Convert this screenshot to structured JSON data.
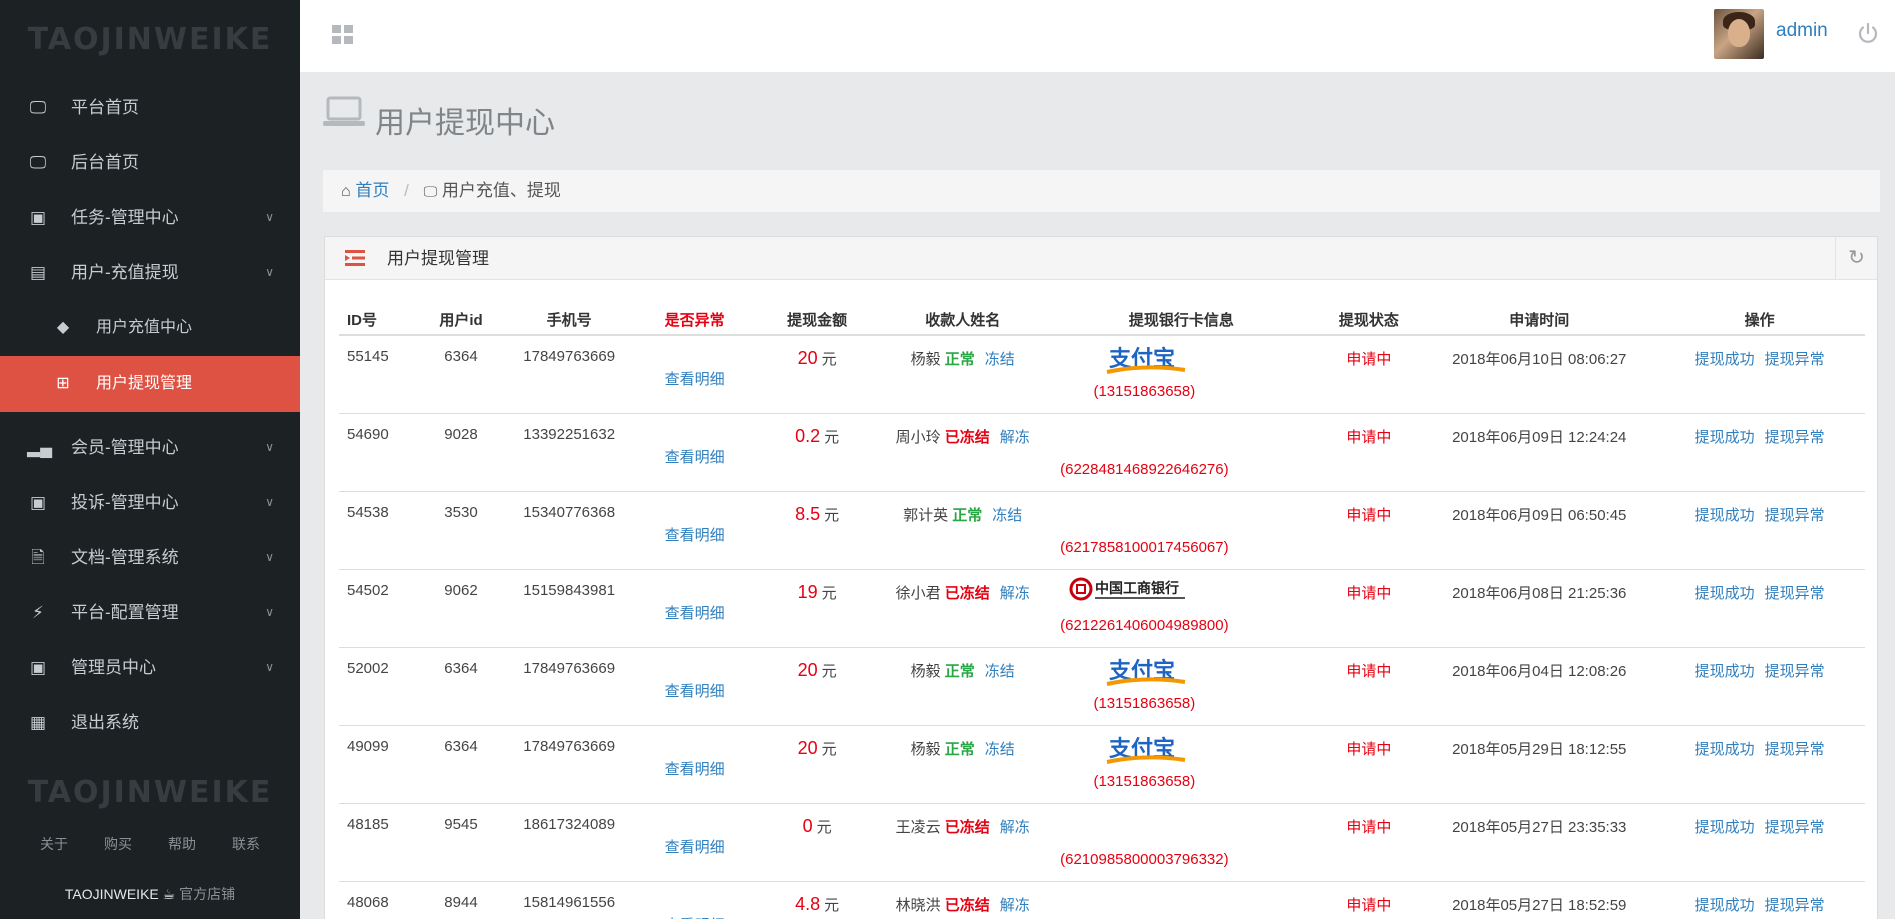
{
  "brand": "TAOJINWEIKE",
  "sidebar": {
    "items": [
      {
        "label": "平台首页",
        "icon": "laptop-icon"
      },
      {
        "label": "后台首页",
        "icon": "laptop-icon"
      },
      {
        "label": "任务-管理中心",
        "icon": "briefcase-icon"
      },
      {
        "label": "用户-充值提现",
        "icon": "list-alt-icon"
      },
      {
        "label": "用户充值中心",
        "icon": "tags-icon"
      },
      {
        "label": "用户提现管理",
        "icon": "plus-square-icon"
      },
      {
        "label": "会员-管理中心",
        "icon": "signal-icon"
      },
      {
        "label": "投诉-管理中心",
        "icon": "briefcase-icon"
      },
      {
        "label": "文档-管理系统",
        "icon": "file-text-icon"
      },
      {
        "label": "平台-配置管理",
        "icon": "bolt-icon"
      },
      {
        "label": "管理员中心",
        "icon": "briefcase-icon"
      },
      {
        "label": "退出系统",
        "icon": "calendar-icon"
      }
    ],
    "footer_brand": "TAOJINWEIKE",
    "footer_links": [
      "关于",
      "购买",
      "帮助",
      "联系"
    ],
    "shop_brand": "TAOJINWEIKE",
    "shop_label": "官方店铺"
  },
  "topbar": {
    "username": "admin"
  },
  "page": {
    "title": "用户提现中心"
  },
  "breadcrumb": {
    "home": "首页",
    "current": "用户充值、提现"
  },
  "panel": {
    "title": "用户提现管理"
  },
  "table": {
    "headers": [
      "ID号",
      "用户id",
      "手机号",
      "是否异常",
      "提现金额",
      "收款人姓名",
      "提现银行卡信息",
      "提现状态",
      "申请时间",
      "操作"
    ],
    "detail_label": "查看明细",
    "currency_unit": "元",
    "op_success": "提现成功",
    "op_abnormal": "提现异常",
    "rows": [
      {
        "id": "55145",
        "uid": "6364",
        "phone": "17849763669",
        "amount": "20",
        "name": "杨毅",
        "status": "正常",
        "action": "冻结",
        "bank_logo": "alipay",
        "account": "(13151863658)",
        "state": "申请中",
        "time": "2018年06月10日 08:06:27"
      },
      {
        "id": "54690",
        "uid": "9028",
        "phone": "13392251632",
        "amount": "0.2",
        "name": "周小玲",
        "status": "已冻结",
        "action": "解冻",
        "bank_logo": "",
        "account": "(6228481468922646276)",
        "state": "申请中",
        "time": "2018年06月09日 12:24:24"
      },
      {
        "id": "54538",
        "uid": "3530",
        "phone": "15340776368",
        "amount": "8.5",
        "name": "郭计英",
        "status": "正常",
        "action": "冻结",
        "bank_logo": "",
        "account": "(6217858100017456067)",
        "state": "申请中",
        "time": "2018年06月09日 06:50:45"
      },
      {
        "id": "54502",
        "uid": "9062",
        "phone": "15159843981",
        "amount": "19",
        "name": "徐小君",
        "status": "已冻结",
        "action": "解冻",
        "bank_logo": "icbc",
        "account": "(6212261406004989800)",
        "state": "申请中",
        "time": "2018年06月08日 21:25:36"
      },
      {
        "id": "52002",
        "uid": "6364",
        "phone": "17849763669",
        "amount": "20",
        "name": "杨毅",
        "status": "正常",
        "action": "冻结",
        "bank_logo": "alipay",
        "account": "(13151863658)",
        "state": "申请中",
        "time": "2018年06月04日 12:08:26"
      },
      {
        "id": "49099",
        "uid": "6364",
        "phone": "17849763669",
        "amount": "20",
        "name": "杨毅",
        "status": "正常",
        "action": "冻结",
        "bank_logo": "alipay",
        "account": "(13151863658)",
        "state": "申请中",
        "time": "2018年05月29日 18:12:55"
      },
      {
        "id": "48185",
        "uid": "9545",
        "phone": "18617324089",
        "amount": "0",
        "name": "王凌云",
        "status": "已冻结",
        "action": "解冻",
        "bank_logo": "",
        "account": "(6210985800003796332)",
        "state": "申请中",
        "time": "2018年05月27日 23:35:33"
      },
      {
        "id": "48068",
        "uid": "8944",
        "phone": "15814961556",
        "amount": "4.8",
        "name": "林晓洪",
        "status": "已冻结",
        "action": "解冻",
        "bank_logo": "",
        "account": "",
        "state": "申请中",
        "time": "2018年05月27日 18:52:59"
      }
    ]
  },
  "colors": {
    "sidebar_bg": "#1c2124",
    "active": "#dd5243",
    "link": "#2f7fbf",
    "danger": "#e60012",
    "ok": "#28a745"
  }
}
